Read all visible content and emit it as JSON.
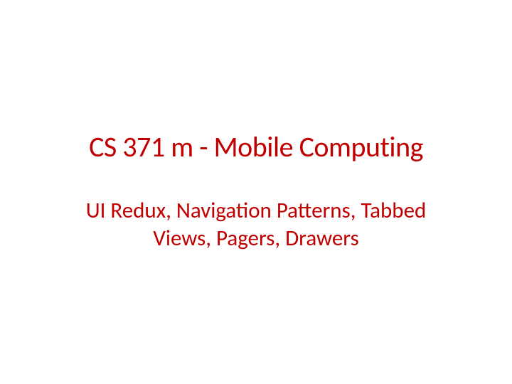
{
  "slide": {
    "title": "CS 371 m - Mobile Computing",
    "subtitle": "UI Redux, Navigation Patterns, Tabbed Views, Pagers, Drawers"
  }
}
